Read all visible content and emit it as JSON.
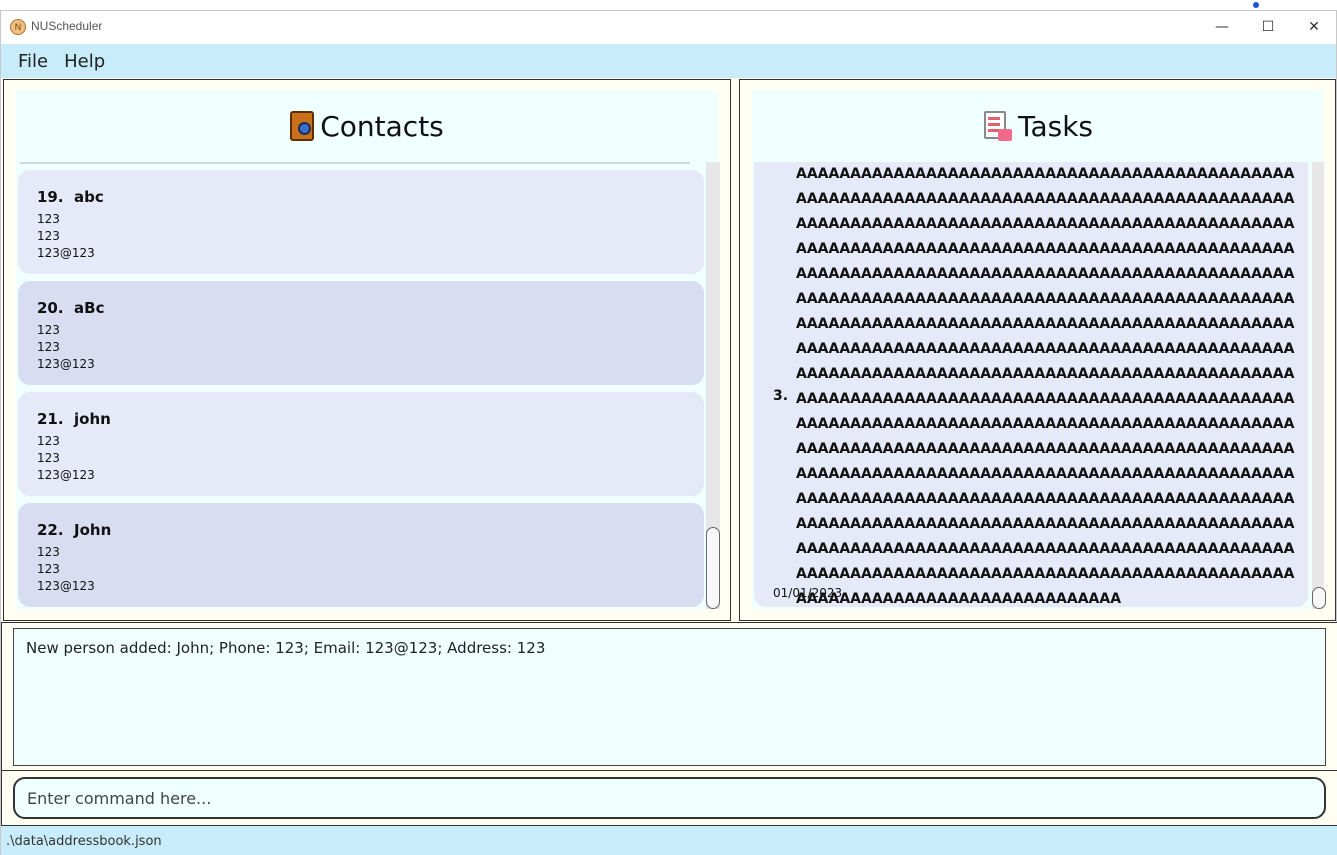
{
  "window": {
    "title": "NUScheduler",
    "app_icon_glyph": "N",
    "minimize_glyph": "—",
    "maximize_glyph": "☐",
    "close_glyph": "✕"
  },
  "menu": {
    "items": [
      "File",
      "Help"
    ]
  },
  "contacts": {
    "title": "Contacts",
    "icon": "address-book-icon",
    "persons": [
      {
        "index": "19.",
        "name": "abc",
        "phone": "123",
        "address": "123",
        "email": "123@123"
      },
      {
        "index": "20.",
        "name": "aBc",
        "phone": "123",
        "address": "123",
        "email": "123@123"
      },
      {
        "index": "21.",
        "name": "john",
        "phone": "123",
        "address": "123",
        "email": "123@123"
      },
      {
        "index": "22.",
        "name": "John",
        "phone": "123",
        "address": "123",
        "email": "123@123"
      }
    ]
  },
  "tasks": {
    "title": "Tasks",
    "icon": "task-list-icon",
    "items": [
      {
        "index": "3.",
        "description": "AAAAAAAAAAAAAAAAAAAAAAAAAAAAAAAAAAAAAAAAAAAAAAAAAAAAAAAAAAAAAAAAAAAAAAAAAAAAAAAAAAAAAAAAAAAAAAAAAAAAAAAAAAAAAAAAAAAAAAAAAAAAAAAAAAAAAAAAAAAAAAAAAAAAAAAAAAAAAAAAAAAAAAAAAAAAAAAAAAAAAAAAAAAAAAAAAAAAAAAAAAAAAAAAAAAAAAAAAAAAAAAAAAAAAAAAAAAAAAAAAAAAAAAAAAAAAAAAAAAAAAAAAAAAAAAAAAAAAAAAAAAAAAAAAAAAAAAAAAAAAAAAAAAAAAAAAAAAAAAAAAAAAAAAAAAAAAAAAAAAAAAAAAAAAAAAAAAAAAAAAAAAAAAAAAAAAAAAAAAAAAAAAAAAAAAAAAAAAAAAAAAAAAAAAAAAAAAAAAAAAAAAAAAAAAAAAAAAAAAAAAAAAAAAAAAAAAAAAAAAAAAAAAAAAAAAAAAAAAAAAAAAAAAAAAAAAAAAAAAAAAAAAAAAAAAAAAAAAAAAAAAAAAAAAAAAAAAAAAAAAAAAAAAAAAAAAAAAAAAAAAAAAAAAAAAAAAAAAAAAAAAAAAAAAAAAAAAAAAAAAAAAAAAAAAAAAAAAAAAAAAAAAAAAAAAAAAAAAAAAAAAAAAAAAAAAAAAAAAAAAAAAAAAAAAAAAAAAAAAAAAAAAAAAAAAAAAAAAAAAAAAAAAAAAAAAAAAAAAAAAAAAAAAAAAAAAAAAAAAAAAAAAAAAAAAAAAAAAAAAAAAAAAAAAAAAAAAAAAAAAAAAAAAAAAAAAAAAAAAAAAAAAAAAAAAA",
        "date": "01/01/2023"
      }
    ]
  },
  "result": {
    "text": "New person added: John; Phone: 123; Email: 123@123; Address: 123"
  },
  "command": {
    "placeholder": "Enter command here..."
  },
  "status": {
    "path": ".\\data\\addressbook.json"
  },
  "colors": {
    "menubar": "#c8ecf9",
    "panel": "#f0ffff",
    "card_light": "#e6e9f7",
    "card_dark": "#d8ddf2"
  }
}
